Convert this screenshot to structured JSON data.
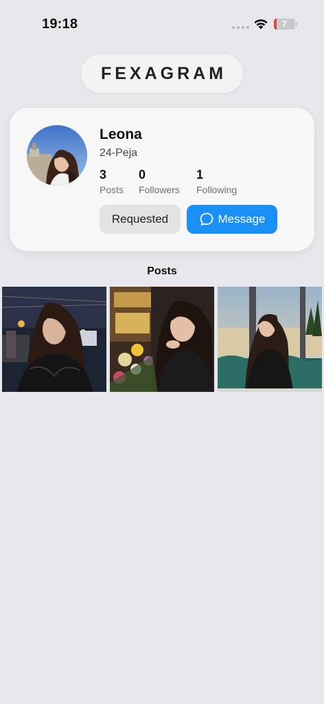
{
  "status_bar": {
    "time": "19:18",
    "battery_level": "7",
    "battery_fraction": 0.07,
    "battery_color": "#e0453f",
    "icons": [
      "cellular-signal-icon",
      "wifi-icon",
      "battery-icon"
    ]
  },
  "app": {
    "title": "FEXAGRAM"
  },
  "profile": {
    "name": "Leona",
    "handle": "24-Peja",
    "avatar": "profile-photo",
    "stats": [
      {
        "value": "3",
        "label": "Posts"
      },
      {
        "value": "0",
        "label": "Followers"
      },
      {
        "value": "1",
        "label": "Following"
      }
    ],
    "actions": {
      "requested_label": "Requested",
      "message_label": "Message",
      "message_icon": "chat-bubble-icon"
    }
  },
  "posts": {
    "heading": "Posts",
    "items": [
      {
        "name": "post-night-street"
      },
      {
        "name": "post-flowers-cafe"
      },
      {
        "name": "post-window-seat"
      }
    ]
  },
  "colors": {
    "accent": "#1a8ff5",
    "background": "#e8e8ec",
    "card": "#f7f7f8"
  }
}
